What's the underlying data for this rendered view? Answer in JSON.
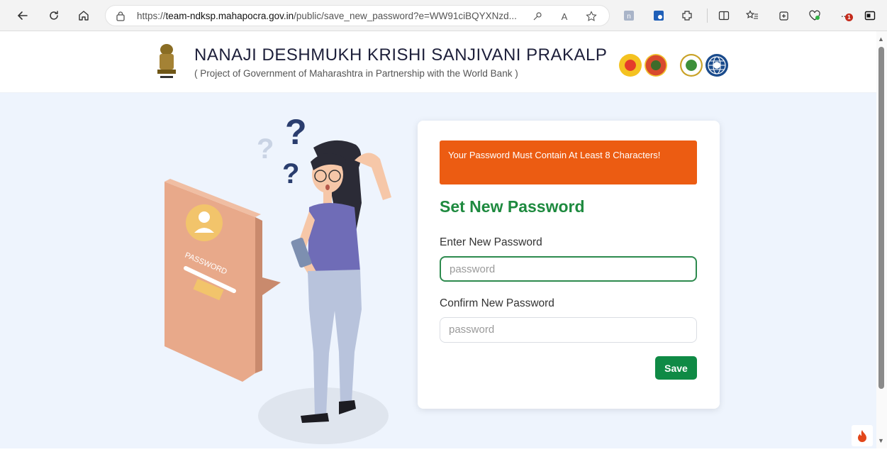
{
  "browser": {
    "url_prefix": "https://",
    "url_host": "team-ndksp.mahapocra.gov.in",
    "url_rest": "/public/save_new_password?e=WW91ciBQYXNzd...",
    "reading_aloud_label": "A",
    "notification_count": "1"
  },
  "header": {
    "title": "NANAJI DESHMUKH KRISHI SANJIVANI PRAKALP",
    "subtitle": "( Project of Government of Maharashtra in Partnership with the World Bank )"
  },
  "illustration": {
    "badge_text": "PASSWORD"
  },
  "alert": {
    "message": "Your Password Must Contain At Least 8 Characters!"
  },
  "form": {
    "title": "Set New Password",
    "new_label": "Enter New Password",
    "new_placeholder": "password",
    "confirm_label": "Confirm New Password",
    "confirm_placeholder": "password",
    "save_label": "Save"
  },
  "colors": {
    "alert": "#ec5c12",
    "title_green": "#1e8a3f",
    "save_green": "#0f8a45",
    "page_bg": "#eef4fd"
  },
  "icons": [
    "back-icon",
    "refresh-icon",
    "home-icon",
    "site-info-icon",
    "key-icon",
    "read-aloud-icon",
    "favorite-star-icon",
    "extension-icon",
    "split-screen-icon",
    "favorites-icon",
    "collections-icon",
    "browser-essentials-icon",
    "more-icon",
    "sidebar-icon",
    "flame-icon"
  ]
}
